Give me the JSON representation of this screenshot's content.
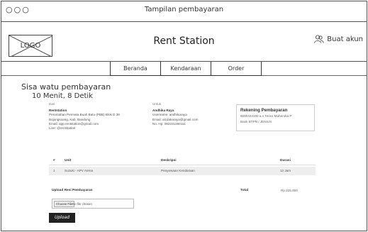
{
  "window": {
    "controls": "○○○",
    "title": "Tampilan pembayaran"
  },
  "header": {
    "logo_text": "LOGO",
    "brand": "Rent Station",
    "account_label": "Buat akun"
  },
  "nav": {
    "items": [
      "Beranda",
      "Kendaraan",
      "Order"
    ]
  },
  "timer": {
    "label": "Sisa watu pembayaran",
    "value": "10 Menit, 8 Detik"
  },
  "invoice": {
    "from": {
      "label": "Dari",
      "name": "Rentstation",
      "address_1": "Perumahan Permata Buah Batu (PBB) Blok D 39",
      "address_2": "Bojongsoang, Kab. Bandung",
      "email": "Email: app.rentstation@gmail.com",
      "line": "Line: @rentstation"
    },
    "to": {
      "label": "Untuk",
      "name": "Andhika Raya",
      "username": "Username: andhikaraya",
      "email": "Email: alcdakaraya@gmail.com",
      "phone": "No. Hp: 082231350111"
    },
    "rekening": {
      "heading": "Rekening Pembayaran",
      "account": "9000422150 a.n Tecko Maheroka P",
      "bank": "Bank BTPN / JENIUS"
    },
    "table": {
      "headers": [
        "#",
        "Unit",
        "Deskripsi",
        "Durasi"
      ],
      "rows": [
        [
          "1",
          "Suzuki - APV Arena",
          "Penyewaan Kendaraan",
          "12 Jam"
        ]
      ]
    },
    "upload_label": "Upload Resi Pembayaran",
    "total_label": "Total",
    "total_value": "Rp 325.000",
    "file_button": "Choose File",
    "file_none": "No file chosen",
    "upload_button": "Upload"
  }
}
